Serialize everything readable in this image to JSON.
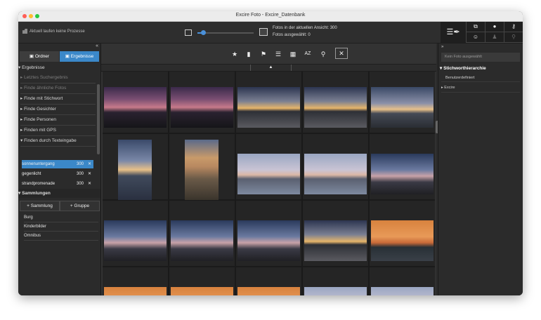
{
  "window": {
    "title": "Excire Foto - Excire_Datenbank"
  },
  "colors": {
    "accent": "#3b88c9",
    "close": "#ff5f57",
    "minimize": "#febc2e",
    "zoom": "#28c840"
  },
  "topbar": {
    "process_text": "Aktuell laufen keine Prozesse",
    "zoom_value": 0.08,
    "stats_line1": "Fotos in der aktuellen Ansicht: 300",
    "stats_line2": "Fotos ausgewählt: 0"
  },
  "left": {
    "tabs": [
      {
        "label": "Ordner",
        "icon": "folder-icon"
      },
      {
        "label": "Ergebnisse",
        "icon": "results-icon"
      }
    ],
    "results_header": "Ergebnisse",
    "search_items": [
      {
        "label": "Letztes Suchergebnis",
        "dim": true
      },
      {
        "label": "Finde ähnliche Fotos",
        "dim": true
      },
      {
        "label": "Finde mit Stichwort",
        "dim": false
      },
      {
        "label": "Finde Gesichter",
        "dim": false
      },
      {
        "label": "Finde Personen",
        "dim": false
      },
      {
        "label": "Finden mit GPS",
        "dim": false
      },
      {
        "label": "Finden durch Texteingabe",
        "dim": false
      }
    ],
    "text_results": [
      {
        "label": "sonnenuntergang",
        "count": "300",
        "selected": true
      },
      {
        "label": "gegenlicht",
        "count": "300",
        "selected": false
      },
      {
        "label": "strandpromenade",
        "count": "300",
        "selected": false
      }
    ],
    "collections_header": "Sammlungen",
    "add_collection_label": "+ Sammlung",
    "add_group_label": "+ Gruppe",
    "collections": [
      "Burg",
      "Kinderbilder",
      "Omnibus"
    ]
  },
  "toolbar": {
    "icons": [
      "star-icon",
      "label-icon",
      "flag-icon",
      "list-icon",
      "calendar-icon",
      "sort-az-icon",
      "search-icon"
    ]
  },
  "right": {
    "no_photo": "Kein Foto ausgewählt",
    "keyword_header": "Stichworthierarchie",
    "rows": [
      "Benutzerdefiniert",
      "Excire"
    ]
  }
}
